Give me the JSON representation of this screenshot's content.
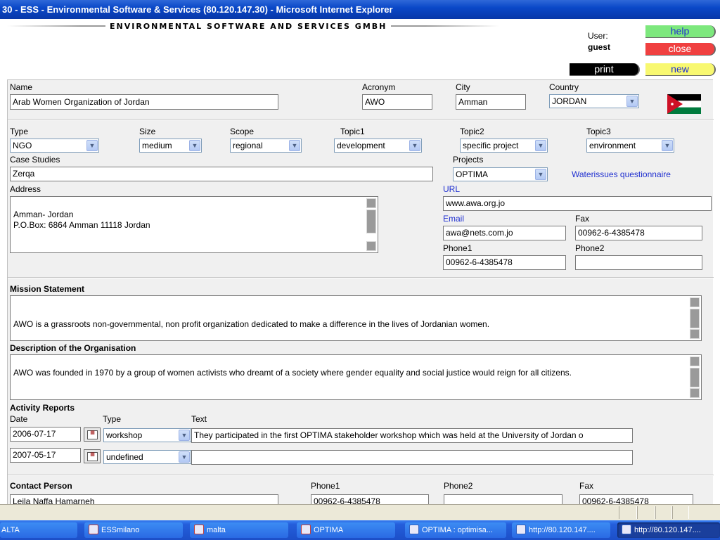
{
  "window": {
    "title": "30 - ESS - Environmental Software & Services (80.120.147.30) - Microsoft Internet Explorer"
  },
  "header": {
    "company": "ENVIRONMENTAL SOFTWARE AND SERVICES GMBH",
    "user_label": "User:",
    "user_name": "guest",
    "help_label": "help",
    "close_label": "close",
    "print_label": "print",
    "new_label": "new",
    "colors": {
      "help": "#7de87d",
      "close": "#f04040",
      "print": "#000000",
      "new": "#f8f870"
    }
  },
  "org": {
    "name_label": "Name",
    "name": "Arab Women Organization of Jordan",
    "acronym_label": "Acronym",
    "acronym": "AWO",
    "city_label": "City",
    "city": "Amman",
    "country_label": "Country",
    "country": "JORDAN",
    "flag_icon": "jordan-flag-icon"
  },
  "classification": {
    "type_label": "Type",
    "type": "NGO",
    "size_label": "Size",
    "size": "medium",
    "scope_label": "Scope",
    "scope": "regional",
    "topic1_label": "Topic1",
    "topic1": "development",
    "topic2_label": "Topic2",
    "topic2": "specific project",
    "topic3_label": "Topic3",
    "topic3": "environment",
    "case_studies_label": "Case Studies",
    "case_studies": "Zerqa",
    "projects_label": "Projects",
    "project": "OPTIMA",
    "questionnaire_link": "Waterissues questionnaire"
  },
  "contact": {
    "address_label": "Address",
    "address": "Amman- Jordan\nP.O.Box: 6864 Amman 11118 Jordan",
    "url_label": "URL",
    "url": "www.awa.org.jo",
    "email_label": "Email",
    "email": "awa@nets.com.jo",
    "fax_label": "Fax",
    "fax": "00962-6-4385478",
    "phone1_label": "Phone1",
    "phone1": "00962-6-4385478",
    "phone2_label": "Phone2",
    "phone2": ""
  },
  "mission": {
    "label": "Mission Statement",
    "text": "AWO is a grassroots non-governmental, non profit organization dedicated to make a difference in the lives of Jordanian women."
  },
  "description": {
    "label": "Description of the Organisation",
    "text": "AWO was founded in 1970 by a group of women activists who dreamt of a society where gender equality and social justice would reign for all citizens."
  },
  "activity": {
    "label": "Activity Reports",
    "col_date": "Date",
    "col_type": "Type",
    "col_text": "Text",
    "rows": [
      {
        "date": "2006-07-17",
        "type": "workshop",
        "text": "They participated in the first OPTIMA stakeholder workshop which was held at the University of Jordan o"
      },
      {
        "date": "2007-05-17",
        "type": "undefined",
        "text": ""
      }
    ]
  },
  "contact_person": {
    "label": "Contact Person",
    "name": "Leila Naffa Hamarneh",
    "phone1_label": "Phone1",
    "phone1": "00962-6-4385478",
    "phone2_label": "Phone2",
    "phone2": "",
    "fax_label": "Fax",
    "fax": "00962-6-4385478"
  },
  "taskbar": {
    "items": [
      "ALTA",
      "ESSmilano",
      "malta",
      "OPTIMA",
      "OPTIMA : optimisa...",
      "http://80.120.147....",
      "http://80.120.147...."
    ]
  }
}
